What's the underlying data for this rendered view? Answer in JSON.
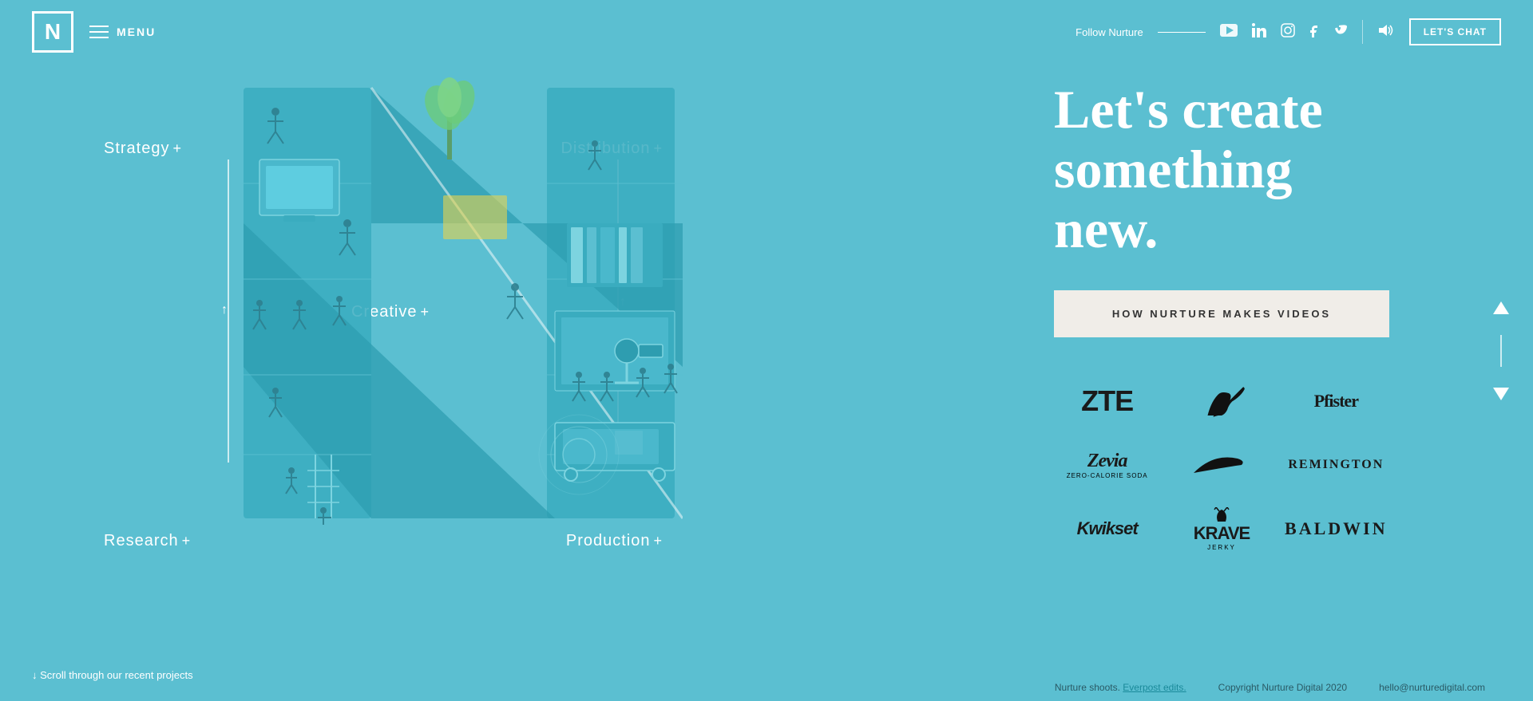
{
  "header": {
    "logo": "N",
    "menu_label": "MENU",
    "follow_label": "Follow Nurture",
    "social_icons": [
      "youtube",
      "linkedin",
      "instagram",
      "facebook",
      "vimeo"
    ],
    "lets_chat": "LET'S CHAT"
  },
  "hero": {
    "heading_line1": "Let's create",
    "heading_line2": "something",
    "heading_line3": "new.",
    "cta_button": "HOW NURTURE MAKES VIDEOS"
  },
  "nav_labels": {
    "strategy": "Strategy",
    "distribution": "Distribution",
    "creative": "Creative",
    "research": "Research",
    "production": "Production",
    "plus": "+"
  },
  "brands": [
    {
      "name": "ZTE",
      "class": "zte"
    },
    {
      "name": "PUMA",
      "class": "puma"
    },
    {
      "name": "Pfister",
      "class": "pfister"
    },
    {
      "name": "Zevia",
      "class": "zevia",
      "sub": "ZERO-CALORIE SODA"
    },
    {
      "name": "Nike",
      "class": "nike",
      "symbol": "✓"
    },
    {
      "name": "REMINGTON",
      "class": "remington"
    },
    {
      "name": "Kwikset",
      "class": "kwikset"
    },
    {
      "name": "KRAVE",
      "class": "krave",
      "sub": "JERKY"
    },
    {
      "name": "BALDWIN",
      "class": "baldwin"
    }
  ],
  "scroll": {
    "label": "↓ Scroll through our recent projects"
  },
  "footer": {
    "nurture_text": "Nurture shoots.",
    "everpost_text": "Everpost edits.",
    "copyright": "Copyright Nurture Digital 2020",
    "email": "hello@nurturedigital.com"
  }
}
